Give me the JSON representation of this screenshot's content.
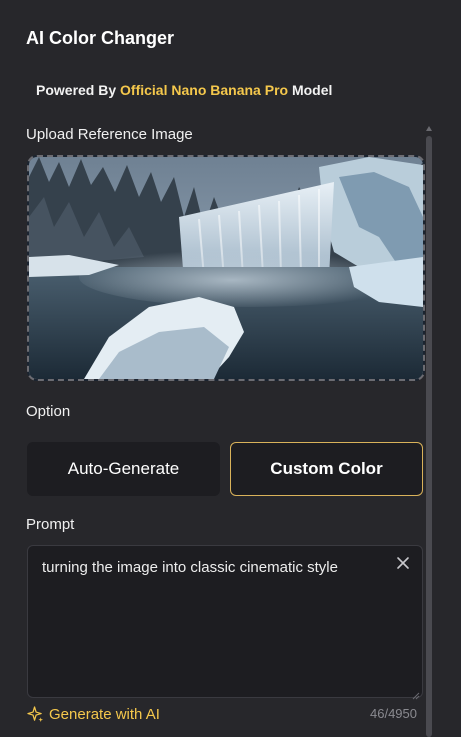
{
  "header": {
    "title": "AI Color Changer",
    "powered_prefix": "Powered By",
    "powered_highlight": "Official Nano Banana Pro",
    "powered_suffix": "Model"
  },
  "upload": {
    "label": "Upload Reference Image",
    "image_description": "frozen waterfall with snowy trees, icy rocks and misty water"
  },
  "option": {
    "label": "Option",
    "buttons": [
      {
        "label": "Auto-Generate",
        "selected": false
      },
      {
        "label": "Custom Color",
        "selected": true
      }
    ]
  },
  "prompt": {
    "label": "Prompt",
    "value": "turning the image into classic cinematic style",
    "counter": "46/4950",
    "generate_label": "Generate with AI"
  },
  "colors": {
    "accent": "#f5c84c",
    "panel_bg": "#27272b",
    "button_bg": "#1d1d21",
    "selected_border": "#d9b25a"
  }
}
